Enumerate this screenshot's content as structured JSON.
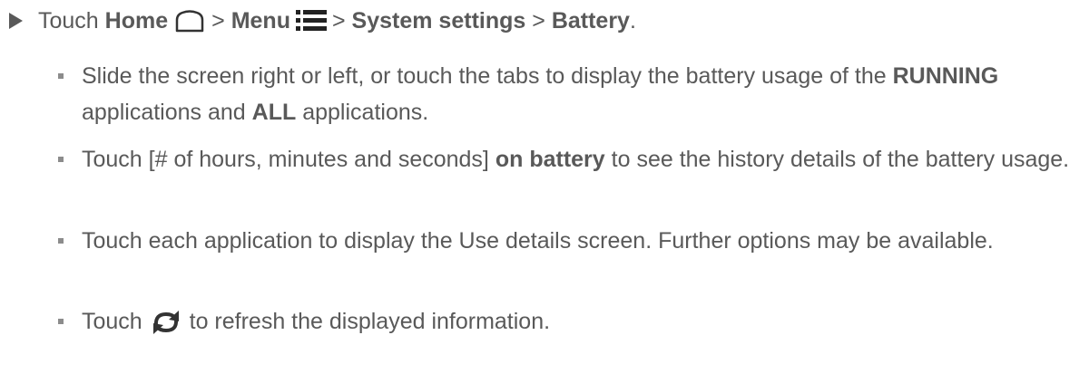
{
  "step": {
    "touch": "Touch",
    "home": "Home",
    "sep1": ">",
    "menu": "Menu",
    "sep2": ">",
    "system_settings": "System settings",
    "sep3": ">",
    "battery": "Battery",
    "period": "."
  },
  "bullets": [
    {
      "part1": "Slide the screen right or left, or touch the tabs to display the battery usage of the",
      "running": "RUNNING",
      "part2": "applications and",
      "all": "ALL",
      "part3": "applications."
    },
    {
      "part1": "Touch [# of hours, minutes and seconds]",
      "on_battery": "on battery",
      "part2": "to see the history details of the battery usage."
    },
    {
      "text": "Touch each application to display the Use details screen. Further options may be available."
    },
    {
      "part1": "Touch",
      "part2": "to refresh the displayed information."
    }
  ],
  "icons": {
    "home": "home-icon",
    "menu": "menu-icon",
    "refresh": "refresh-icon"
  },
  "colors": {
    "text": "#595959",
    "bullet_square": "#8c8c8c"
  }
}
